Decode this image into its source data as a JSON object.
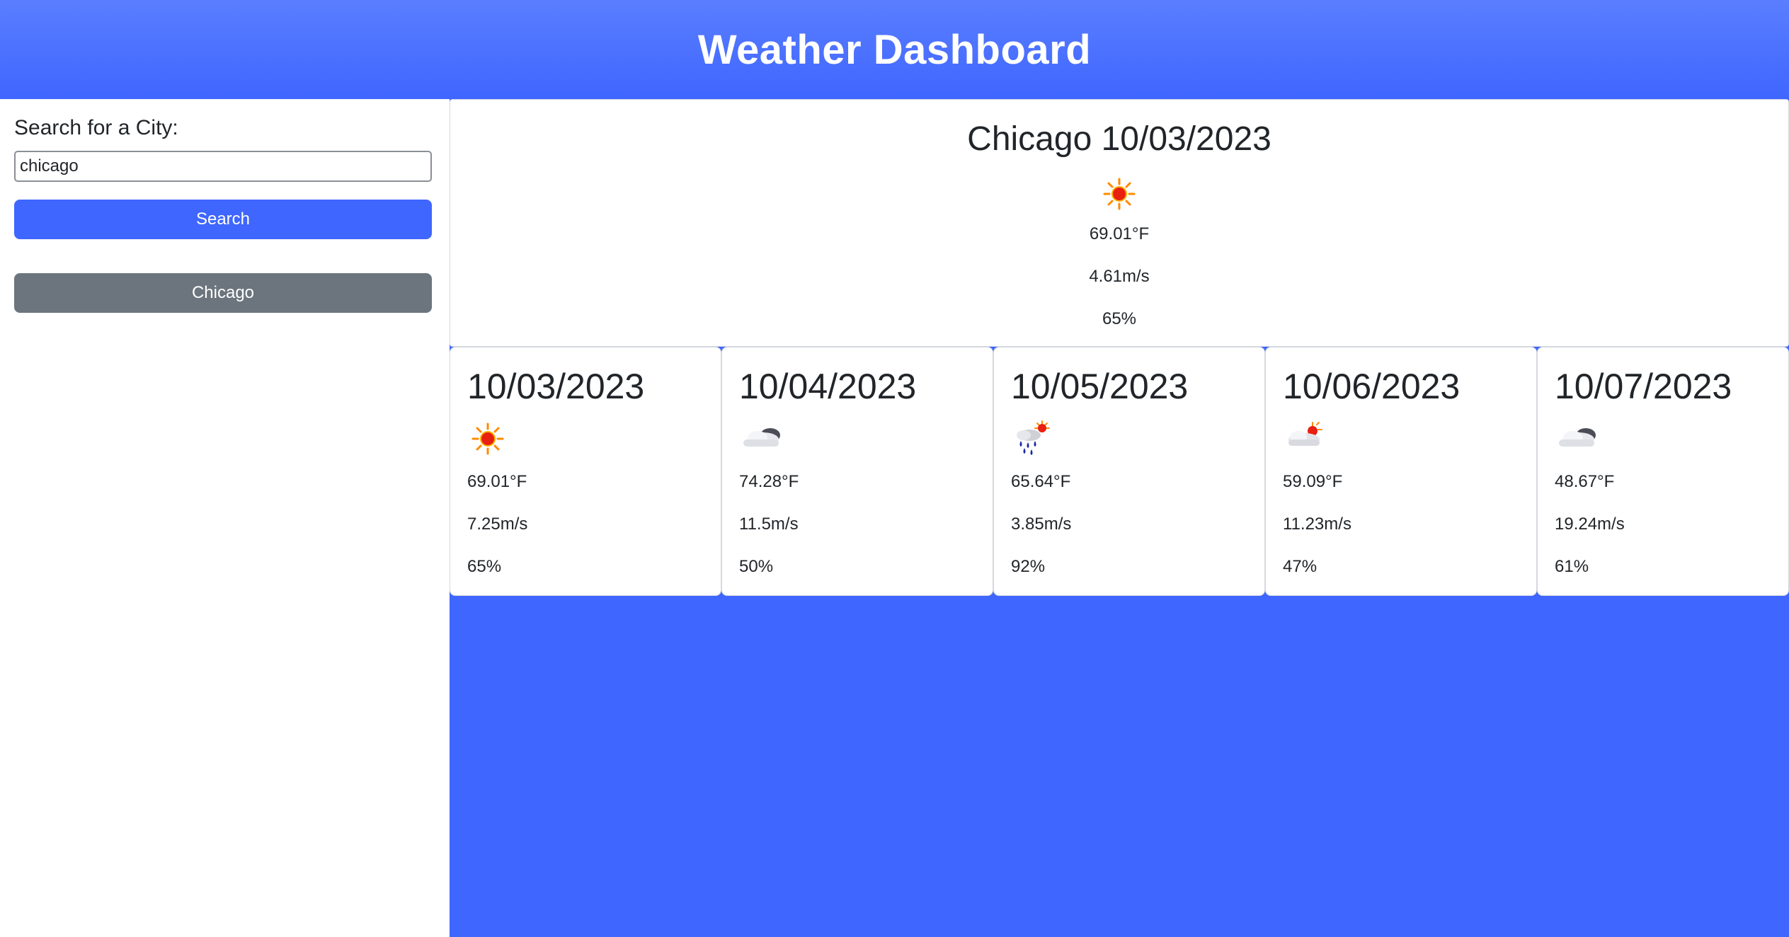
{
  "header": {
    "title": "Weather Dashboard"
  },
  "sidebar": {
    "search_label": "Search for a City:",
    "search_value": "chicago",
    "search_button": "Search",
    "history": [
      "Chicago"
    ]
  },
  "current": {
    "title": "Chicago 10/03/2023",
    "icon": "sun-icon",
    "temp": "69.01°F",
    "wind": "4.61m/s",
    "humidity": "65%"
  },
  "forecast": [
    {
      "date": "10/03/2023",
      "icon": "sun-icon",
      "temp": "69.01°F",
      "wind": "7.25m/s",
      "humidity": "65%"
    },
    {
      "date": "10/04/2023",
      "icon": "cloud-icon",
      "temp": "74.28°F",
      "wind": "11.5m/s",
      "humidity": "50%"
    },
    {
      "date": "10/05/2023",
      "icon": "rain-sun-icon",
      "temp": "65.64°F",
      "wind": "3.85m/s",
      "humidity": "92%"
    },
    {
      "date": "10/06/2023",
      "icon": "partly-cloudy-icon",
      "temp": "59.09°F",
      "wind": "11.23m/s",
      "humidity": "47%"
    },
    {
      "date": "10/07/2023",
      "icon": "cloud-icon",
      "temp": "48.67°F",
      "wind": "19.24m/s",
      "humidity": "61%"
    }
  ],
  "colors": {
    "accent": "#3f66ff",
    "secondary": "#6c757d",
    "sun": "#ff8a00",
    "sun_core": "#e8200f"
  }
}
